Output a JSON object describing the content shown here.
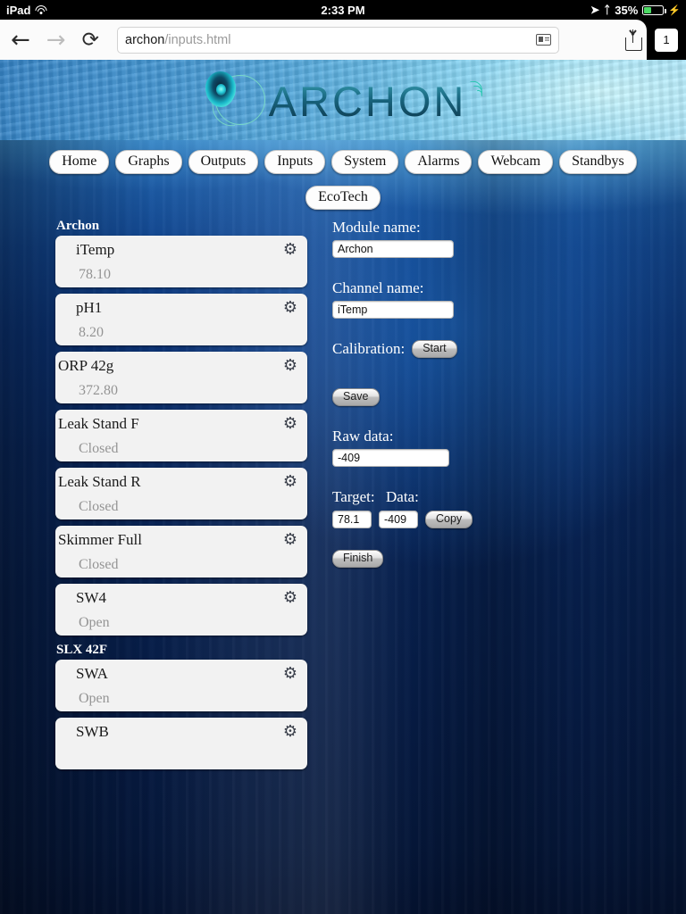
{
  "statusbar": {
    "device": "iPad",
    "wifi_icon": "wifi-icon",
    "time": "2:33 PM",
    "location_icon": "location-arrow-icon",
    "bluetooth_icon": "bluetooth-icon",
    "battery_percent": "35%",
    "battery_level": 35,
    "charging_icon": "lightning-bolt-icon",
    "battery_color": "#4cd964"
  },
  "browser": {
    "back_icon": "back-arrow-icon",
    "forward_icon": "forward-arrow-icon",
    "reload_icon": "reload-icon",
    "url_domain": "archon",
    "url_path": "/inputs.html",
    "reader_icon": "reader-view-icon",
    "share_icon": "share-icon",
    "bookmark_icon": "bookmark-star-icon",
    "tab_count": "1"
  },
  "site": {
    "logo_text": "ARCHON",
    "logo_mark_icon": "archon-droplet-icon",
    "logo_wifi_icon": "wifi-signal-icon"
  },
  "nav": {
    "row1": [
      "Home",
      "Graphs",
      "Outputs",
      "Inputs",
      "System",
      "Alarms",
      "Webcam",
      "Standbys"
    ],
    "row2": [
      "EcoTech"
    ]
  },
  "modules": [
    {
      "name": "Archon",
      "channels": [
        {
          "label": "iTemp",
          "value": "78.10",
          "indent": 1,
          "gear_icon": "gear-icon"
        },
        {
          "label": "pH1",
          "value": "8.20",
          "indent": 1,
          "gear_icon": "gear-icon"
        },
        {
          "label": "ORP 42g",
          "value": "372.80",
          "indent": 0,
          "gear_icon": "gear-icon"
        },
        {
          "label": "Leak Stand F",
          "value": "Closed",
          "indent": 0,
          "gear_icon": "gear-icon"
        },
        {
          "label": "Leak Stand R",
          "value": "Closed",
          "indent": 0,
          "gear_icon": "gear-icon"
        },
        {
          "label": "Skimmer Full",
          "value": "Closed",
          "indent": 0,
          "gear_icon": "gear-icon"
        },
        {
          "label": "SW4",
          "value": "Open",
          "indent": 1,
          "gear_icon": "gear-icon"
        }
      ]
    },
    {
      "name": "SLX 42F",
      "channels": [
        {
          "label": "SWA",
          "value": "Open",
          "indent": 1,
          "gear_icon": "gear-icon"
        },
        {
          "label": "SWB",
          "value": "",
          "indent": 1,
          "gear_icon": "gear-icon"
        }
      ]
    }
  ],
  "form": {
    "module_name_label": "Module name:",
    "module_name_value": "Archon",
    "channel_name_label": "Channel name:",
    "channel_name_value": "iTemp",
    "calibration_label": "Calibration:",
    "start_button": "Start",
    "save_button": "Save",
    "raw_data_label": "Raw data:",
    "raw_data_value": "-409",
    "target_label": "Target:",
    "target_value": "78.1",
    "data_label": "Data:",
    "data_value": "-409",
    "copy_button": "Copy",
    "finish_button": "Finish"
  }
}
